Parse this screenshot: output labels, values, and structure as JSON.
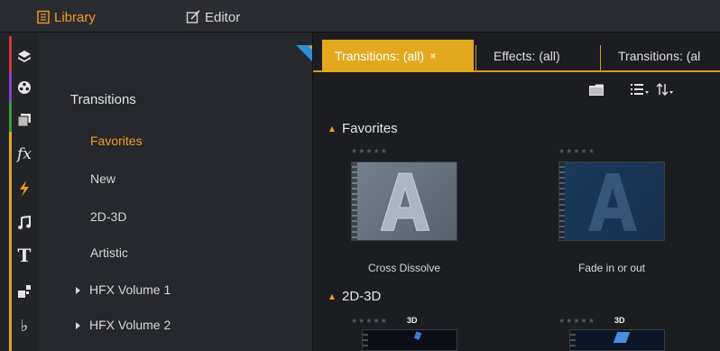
{
  "topbar": {
    "tabs": [
      {
        "label": "Library",
        "icon": "library-icon",
        "active": true
      },
      {
        "label": "Editor",
        "icon": "editor-icon",
        "active": false
      }
    ],
    "accent_color": "#f39b21"
  },
  "rail": {
    "items": [
      {
        "icon": "project-bin-icon",
        "stripe": "#d6363a"
      },
      {
        "icon": "reel-icon",
        "stripe": "#8a3fd1"
      },
      {
        "icon": "collections-icon",
        "stripe": "#3a9b3a"
      },
      {
        "icon": "fx-icon",
        "stripe": "#e3a81d"
      },
      {
        "icon": "lightning-icon",
        "stripe": "#e3a81d"
      },
      {
        "icon": "music-note-icon",
        "stripe": "#e3a81d"
      },
      {
        "icon": "title-icon",
        "stripe": "#e3a81d"
      },
      {
        "icon": "montage-icon",
        "stripe": "#e3a81d"
      },
      {
        "icon": "sound-icon",
        "stripe": "#e3a81d"
      }
    ]
  },
  "category_panel": {
    "heading": "Transitions",
    "items": [
      {
        "label": "Favorites",
        "active": true,
        "expandable": false
      },
      {
        "label": "New",
        "active": false,
        "expandable": false
      },
      {
        "label": "2D-3D",
        "active": false,
        "expandable": false
      },
      {
        "label": "Artistic",
        "active": false,
        "expandable": false
      },
      {
        "label": "HFX Volume 1",
        "active": false,
        "expandable": true
      },
      {
        "label": "HFX Volume 2",
        "active": false,
        "expandable": true
      }
    ]
  },
  "content": {
    "tabs": [
      {
        "label": "Transitions: (all)",
        "active": true,
        "close_icon": "close-icon"
      },
      {
        "label": "Effects: (all)",
        "active": false
      },
      {
        "label": "Transitions: (al",
        "active": false
      }
    ],
    "toolbar_icons": [
      "folder-icon",
      "list-view-icon",
      "sort-icon"
    ],
    "sections": [
      {
        "title": "Favorites",
        "items": [
          {
            "label": "Cross Dissolve",
            "stars": "★★★★★",
            "is3d": false,
            "thumb_color": "#5c6a78"
          },
          {
            "label": "Fade in or out",
            "stars": "★★★★★",
            "is3d": false,
            "thumb_color": "#1f3a5a"
          }
        ]
      },
      {
        "title": "2D-3D",
        "items": [
          {
            "label": "",
            "stars": "★★★★★",
            "is3d": true,
            "badge": "3D",
            "thumb_color": "#0c0f16"
          },
          {
            "label": "",
            "stars": "★★★★★",
            "is3d": true,
            "badge": "3D",
            "thumb_color": "#0c1a2c"
          }
        ]
      }
    ]
  }
}
